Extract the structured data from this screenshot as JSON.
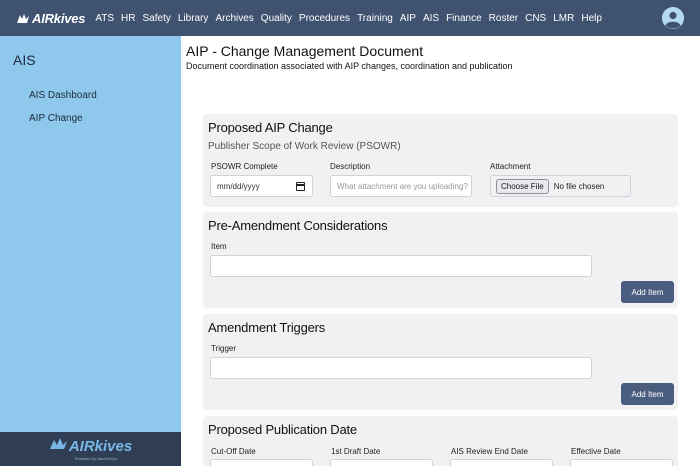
{
  "navbar": {
    "brand": "AIRkives",
    "items": [
      "ATS",
      "HR",
      "Safety",
      "Library",
      "Archives",
      "Quality",
      "Procedures",
      "Training",
      "AIP",
      "AIS",
      "Finance",
      "Roster",
      "CNS",
      "LMR",
      "Help"
    ],
    "avatar_icon": "user-avatar-icon"
  },
  "sidebar": {
    "title": "AIS",
    "links": [
      "AIS Dashboard",
      "AIP Change"
    ],
    "footer_logo": "AIRkives",
    "footer_sub": "Powered by NavInfoSys"
  },
  "page": {
    "title": "AIP - Change Management Document",
    "subtitle": "Document coordination associated with AIP changes, coordination and publication"
  },
  "proposed_change": {
    "title": "Proposed AIP Change",
    "subtitle": "Publisher Scope of Work Review (PSOWR)",
    "psowr_label": "PSOWR Complete",
    "psowr_value": "mm/dd/yyyy",
    "description_label": "Description",
    "description_placeholder": "What attachment are you uploading?",
    "attachment_label": "Attachment",
    "choose_file": "Choose File",
    "no_file": "No file chosen"
  },
  "pre_amendment": {
    "title": "Pre-Amendment Considerations",
    "item_label": "Item",
    "add_button": "Add Item"
  },
  "amendment_triggers": {
    "title": "Amendment Triggers",
    "trigger_label": "Trigger",
    "add_button": "Add Item"
  },
  "publication_date": {
    "title": "Proposed Publication Date",
    "labels": [
      "Cut-Off Date",
      "1st Draft Date",
      "AIS Review End Date",
      "Effective Date"
    ]
  },
  "colors": {
    "navbar": "#3f5370",
    "sidebar": "#8ec8ec",
    "sidebar_footer": "#2f3e54",
    "card": "#f1f1f3",
    "button": "#4a5d7e"
  }
}
